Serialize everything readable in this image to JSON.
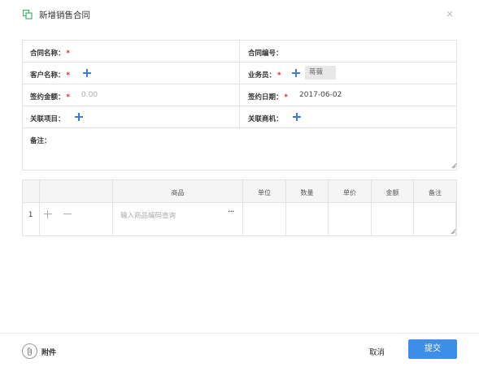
{
  "dialog": {
    "title": "新增销售合同",
    "close_glyph": "×"
  },
  "form": {
    "contract_name_label": "合同名称：",
    "contract_no_label": "合同编号：",
    "customer_label": "客户名称：",
    "salesman_label": "业务员：",
    "salesman_value": "蒋薇",
    "amount_label": "签约金额：",
    "amount_placeholder": "0.00",
    "date_label": "签约日期：",
    "date_value": "2017-06-02",
    "project_label": "关联项目：",
    "opportunity_label": "关联商机：",
    "remark_label": "备注：",
    "required_mark": "*"
  },
  "items": {
    "headers": [
      "商品",
      "单位",
      "数量",
      "单价",
      "金额",
      "备注"
    ],
    "rows": [
      {
        "num": "1",
        "product_placeholder": "输入商品编码查询",
        "more_glyph": "···"
      }
    ]
  },
  "footer": {
    "attach_label": "附件",
    "cancel_label": "取消",
    "submit_label": "提交"
  },
  "colors": {
    "accent": "#3d8ee8",
    "required": "#e02020",
    "icon_green": "#3cb371"
  },
  "icons": [
    "copy-icon",
    "close-icon",
    "plus-icon",
    "minus-icon",
    "more-icon",
    "paperclip-icon"
  ]
}
